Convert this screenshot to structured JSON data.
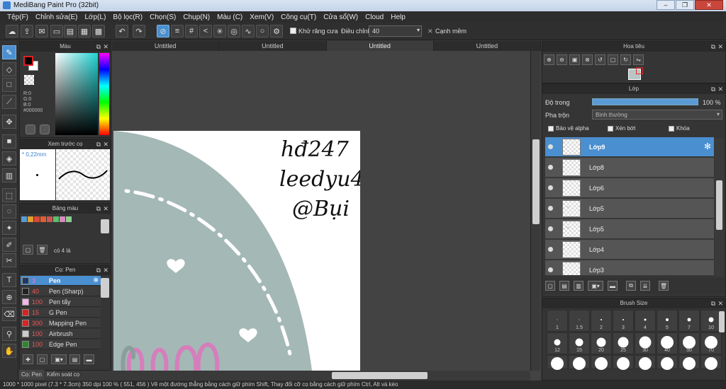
{
  "window": {
    "title": "MediBang Paint Pro (32bit)",
    "buttons": [
      "–",
      "❐",
      "✕"
    ]
  },
  "menu": [
    "Tệp(F)",
    "Chỉnh sửa(E)",
    "Lớp(L)",
    "Bộ lọc(R)",
    "Chọn(S)",
    "Chụp(N)",
    "Màu (C)",
    "Xem(V)",
    "Công cụ(T)",
    "Cửa sổ(W)",
    "Cloud",
    "Help"
  ],
  "toolbar": {
    "antialias_label": "Khử răng cưa",
    "adjust_label": "Điều chỉnh",
    "adjust_value": "40",
    "smooth_label": "Cạnh mềm"
  },
  "color_panel": {
    "title": "Màu",
    "r": "R:0",
    "g": "G:0",
    "b": "B:0",
    "hex": "#000000"
  },
  "brush_preview": {
    "title": "Xem trước cọ",
    "size": "* 0,22mm"
  },
  "palette": {
    "title": "Bảng màu",
    "info": "có 4 lá",
    "colors": [
      "#5b9bd5",
      "#e0a030",
      "#d94a3a",
      "#e06030",
      "#cc5555",
      "#5bbf6b",
      "#d78ac0",
      "#8fcf8f"
    ]
  },
  "brush_panel": {
    "title": "Cọ: Pen",
    "brushes": [
      {
        "size": "3",
        "name": "Pen",
        "color": "#1a3a6a"
      },
      {
        "size": "40",
        "name": "Pen (Sharp)",
        "color": "#222"
      },
      {
        "size": "100",
        "name": "Pen tẩy",
        "color": "#f5b5e8"
      },
      {
        "size": "15",
        "name": "G Pen",
        "color": "#e02020"
      },
      {
        "size": "300",
        "name": "Mapping Pen",
        "color": "#e02020"
      },
      {
        "size": "100",
        "name": "Airbrush",
        "color": "#cccccc"
      },
      {
        "size": "100",
        "name": "Edge Pen",
        "color": "#2a8a2a"
      }
    ]
  },
  "left_tabs": [
    "Cọ: Pen",
    "Kiểm soát cọ"
  ],
  "canvas_tabs": [
    "Untitled",
    "Untitled",
    "Untitled",
    "Untitled"
  ],
  "artwork_text": [
    "hđ247",
    "leedyu4",
    "@Bụi"
  ],
  "status": "1000 * 1000 pixel   (7.3 * 7.3cm)   350 dpi   100 %   ( 551, 456 )   Vẽ một đường thẳng bằng cách giữ phím Shift, Thay đổi cỡ cọ bằng cách giữ phím Ctrl, Alt và kéo",
  "navigator": {
    "title": "Hoa tiêu"
  },
  "layers": {
    "title": "Lớp",
    "opacity_label": "Độ trong",
    "opacity_value": "100 %",
    "blend_label": "Pha trộn",
    "blend_value": "Bình thường",
    "protect_alpha": "Bảo vệ alpha",
    "clipping": "Xén bớt",
    "lock": "Khóa",
    "items": [
      {
        "name": "Lớp9"
      },
      {
        "name": "Lớp8"
      },
      {
        "name": "Lớp6"
      },
      {
        "name": "Lớp5"
      },
      {
        "name": "Lớp5"
      },
      {
        "name": "Lớp4"
      },
      {
        "name": "Lớp3"
      }
    ]
  },
  "brush_size": {
    "title": "Brush Size",
    "row1": [
      "1",
      "1.5",
      "2",
      "3",
      "4",
      "5",
      "7",
      "10"
    ],
    "row2": [
      "12",
      "15",
      "20",
      "25",
      "30",
      "40",
      "50",
      "70"
    ],
    "row3": [
      "",
      "",
      "",
      "",
      "",
      "",
      "",
      ""
    ]
  }
}
